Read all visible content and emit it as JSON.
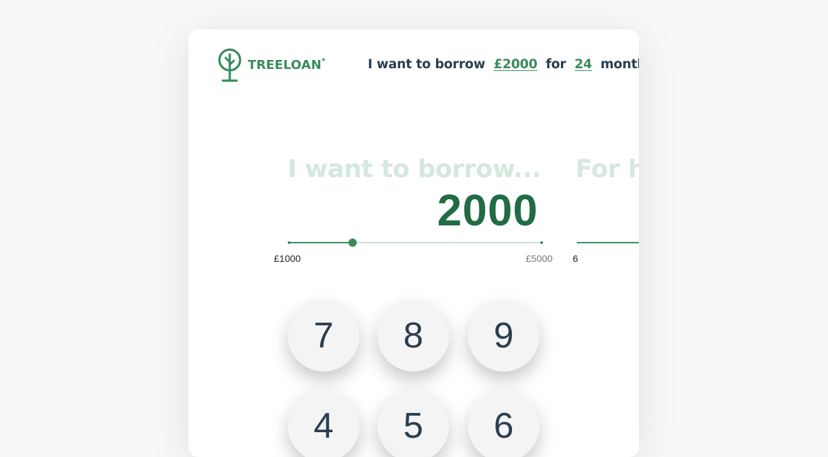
{
  "brand": {
    "name": "TREELOAN",
    "mark": "*",
    "color": "#3a8a5c"
  },
  "summary": {
    "prefix": "I want to borrow",
    "amount_link": "£2000",
    "middle": "for",
    "term_link": "24",
    "suffix": "months"
  },
  "borrow_step": {
    "heading": "I want to borrow...",
    "value": "2000",
    "min_label": "£1000",
    "max_label": "£5000",
    "slider_fraction": 0.25
  },
  "term_step": {
    "heading_partial": "For h",
    "min_label": "6"
  },
  "keypad": {
    "keys": [
      "7",
      "8",
      "9",
      "4",
      "5",
      "6"
    ]
  },
  "colors": {
    "accent": "#3a8a5c",
    "value": "#216b45",
    "text": "#2b3e4f",
    "heading_faded": "#d6e8dd"
  }
}
